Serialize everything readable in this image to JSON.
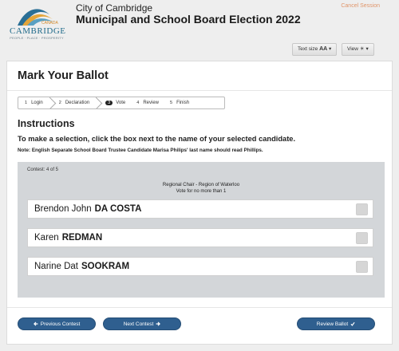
{
  "header": {
    "logo_word": "CAMBRIDGE",
    "logo_country": "CANADA",
    "logo_tagline": "PEOPLE · PLACE · PROSPERITY",
    "city": "City of Cambridge",
    "election_title": "Municipal and School Board Election 2022",
    "cancel_label": "Cancel Session",
    "text_size_label": "Text size",
    "text_size_icon": "AA",
    "view_label": "View"
  },
  "card": {
    "title": "Mark Your Ballot",
    "steps": [
      {
        "num": "1",
        "label": "Login"
      },
      {
        "num": "2",
        "label": "Declaration"
      },
      {
        "num": "3",
        "label": "Vote"
      },
      {
        "num": "4",
        "label": "Review"
      },
      {
        "num": "5",
        "label": "Finish"
      }
    ],
    "active_step": "3",
    "instructions_heading": "Instructions",
    "instructions_text": "To make a selection, click the box next to the name of your selected candidate.",
    "instructions_note": "Note: English Separate School Board Trustee Candidate Marisa Philips' last name should read Phillips."
  },
  "contest": {
    "counter": "Contest: 4 of 5",
    "name": "Regional Chair - Region of Waterloo",
    "rule": "Vote for no more than 1",
    "candidates": [
      {
        "first": "Brendon John",
        "last": "DA COSTA"
      },
      {
        "first": "Karen",
        "last": "REDMAN"
      },
      {
        "first": "Narine Dat",
        "last": "SOOKRAM"
      }
    ]
  },
  "nav": {
    "prev_label": "Previous Contest",
    "next_label": "Next Contest",
    "review_label": "Review Ballot"
  },
  "colors": {
    "accent": "#2f5f8f",
    "cancel": "#e0956a",
    "panel": "#d3d6d9"
  }
}
